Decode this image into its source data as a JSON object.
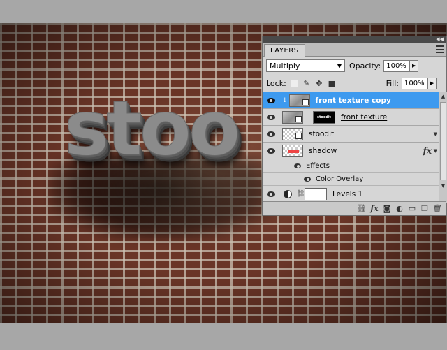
{
  "canvas": {
    "artwork_text": "stoo"
  },
  "panel": {
    "tab_label": "LAYERS",
    "blend_mode": "Multiply",
    "opacity_label": "Opacity:",
    "opacity_value": "100%",
    "lock_label": "Lock:",
    "fill_label": "Fill:",
    "fill_value": "100%",
    "layers": [
      {
        "name": "front texture copy",
        "selected": true
      },
      {
        "name": "front texture",
        "mask_text": "stoodit"
      },
      {
        "name": "stoodit"
      },
      {
        "name": "shadow",
        "fx_label": "fx"
      },
      {
        "name": "Effects"
      },
      {
        "name": "Color Overlay"
      },
      {
        "name": "Levels 1"
      }
    ],
    "bottom_fx_label": "fx"
  },
  "colors": {
    "selection": "#3d9aef",
    "panel_bg": "#d6d6d6"
  }
}
